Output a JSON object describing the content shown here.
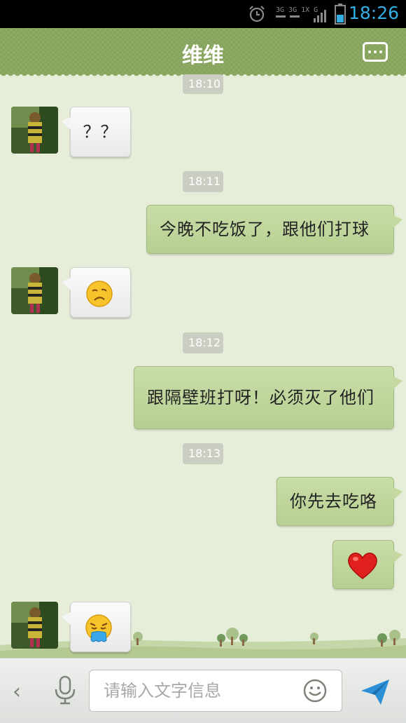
{
  "status_bar": {
    "time": "18:26",
    "network": "3G 3G 1X G"
  },
  "header": {
    "title": "维维"
  },
  "messages": [
    {
      "type": "timestamp",
      "text": "18:10"
    },
    {
      "type": "incoming",
      "text": "？？"
    },
    {
      "type": "timestamp",
      "text": "18:11"
    },
    {
      "type": "outgoing",
      "text": "今晚不吃饭了，跟他们打球"
    },
    {
      "type": "incoming",
      "emoji": "frowning-face-icon"
    },
    {
      "type": "timestamp",
      "text": "18:12"
    },
    {
      "type": "outgoing",
      "text": "跟隔壁班打呀！必须灭了他们"
    },
    {
      "type": "timestamp",
      "text": "18:13"
    },
    {
      "type": "outgoing",
      "text": "你先去吃咯"
    },
    {
      "type": "outgoing",
      "emoji": "heart-icon"
    },
    {
      "type": "incoming",
      "emoji": "drooling-face-icon"
    }
  ],
  "input": {
    "placeholder": "请输入文字信息"
  },
  "colors": {
    "header": "#8aa860",
    "outgoing_bubble": "#c1d69e",
    "incoming_bubble": "#f6f6f6",
    "background": "#e6eeda",
    "status_time": "#33aee3"
  }
}
